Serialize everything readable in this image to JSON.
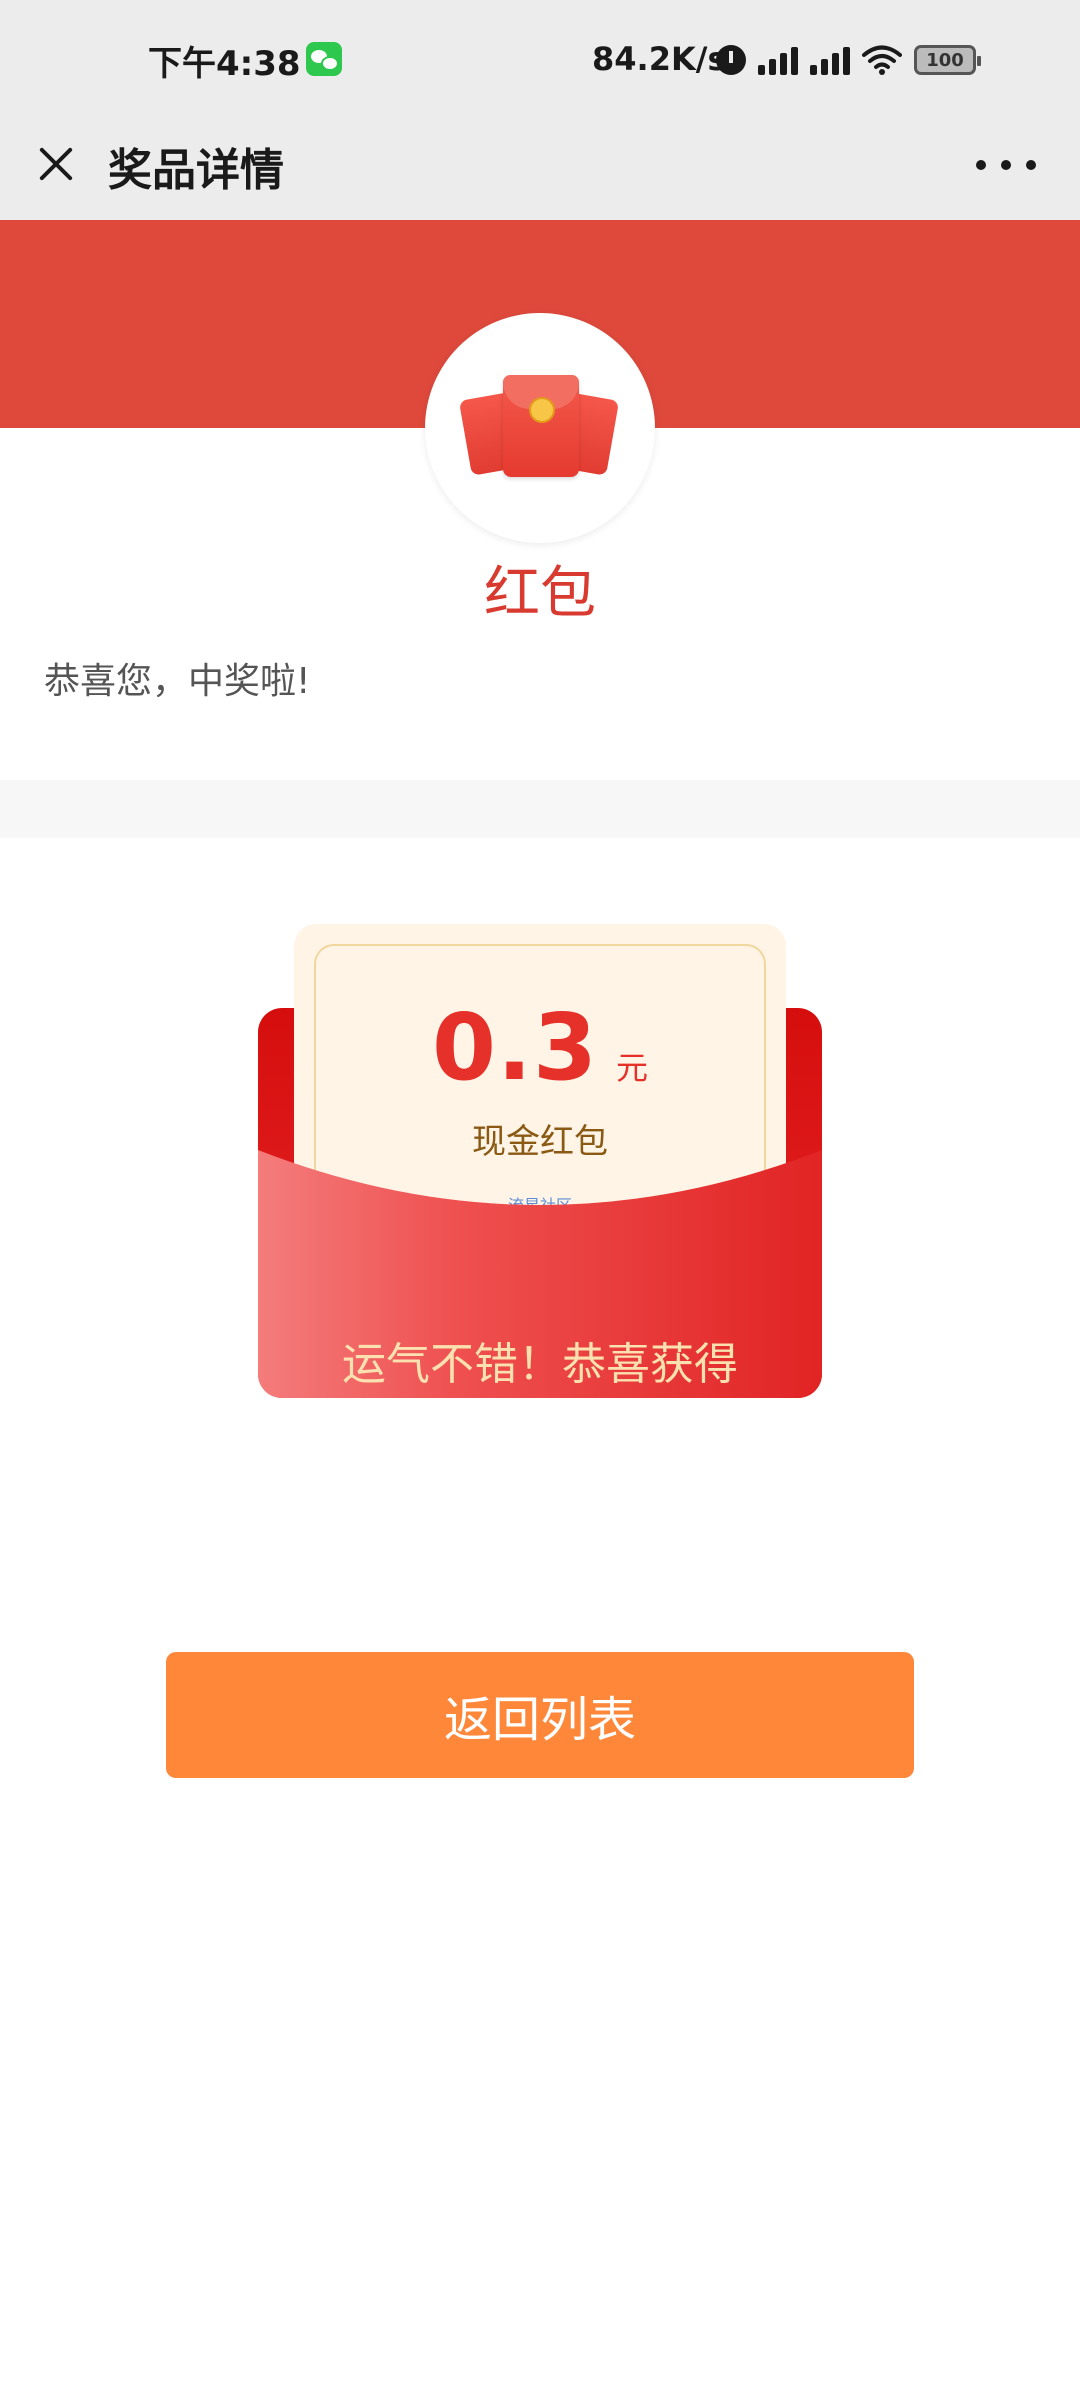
{
  "status_bar": {
    "time": "下午4:38",
    "network_speed": "84.2K/s",
    "battery": "100",
    "icons": [
      "wechat-icon",
      "alarm-icon",
      "signal-icon",
      "signal-icon",
      "wifi-icon",
      "battery-icon"
    ]
  },
  "header": {
    "title": "奖品详情",
    "close_icon": "close-icon",
    "more_icon": "more-icon"
  },
  "prize": {
    "name": "红包",
    "congrats": "恭喜您，中奖啦!",
    "amount": "0.3",
    "unit": "元",
    "type": "现金红包",
    "watermark": "流星社区",
    "slogan": "运气不错！恭喜获得"
  },
  "actions": {
    "back_label": "返回列表"
  },
  "colors": {
    "banner": "#de493c",
    "prize_red": "#e6312a",
    "button_orange": "#ff873a"
  }
}
